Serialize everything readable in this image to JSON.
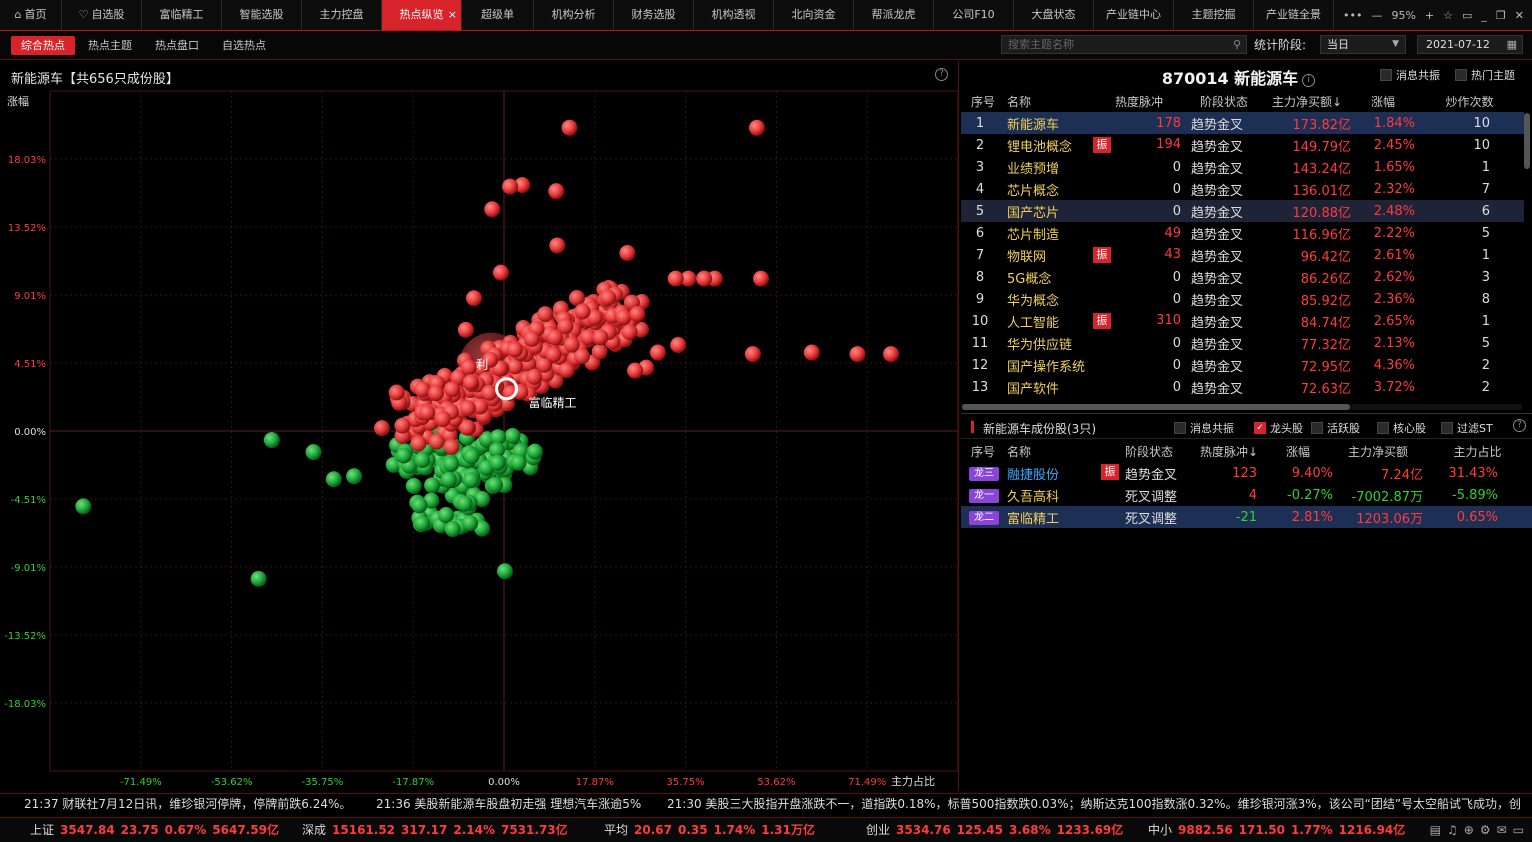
{
  "topbar": {
    "tabs": [
      {
        "label": "首页",
        "icon": "home-icon",
        "w": 62
      },
      {
        "label": "自选股",
        "icon": "heart-icon",
        "w": 80
      },
      {
        "label": "富临精工",
        "w": 80
      },
      {
        "label": "智能选股",
        "w": 80
      },
      {
        "label": "主力控盘",
        "w": 80
      },
      {
        "label": "热点纵览",
        "w": 80,
        "active": true,
        "close": "×"
      },
      {
        "label": "超级单",
        "w": 72
      },
      {
        "label": "机构分析",
        "w": 80
      },
      {
        "label": "财务选股",
        "w": 80
      },
      {
        "label": "机构透视",
        "w": 80
      },
      {
        "label": "北向资金",
        "w": 80
      },
      {
        "label": "帮派龙虎",
        "w": 80
      },
      {
        "label": "公司F10",
        "w": 80
      },
      {
        "label": "大盘状态",
        "w": 80
      },
      {
        "label": "产业链中心",
        "w": 80
      },
      {
        "label": "主题挖掘",
        "w": 80
      },
      {
        "label": "产业链全景",
        "w": 80
      }
    ],
    "zoom": "95%"
  },
  "subbar": {
    "tabs": [
      "综合热点",
      "热点主题",
      "热点盘口",
      "自选热点"
    ],
    "search_placeholder": "搜索主题名称",
    "stat_label": "统计阶段:",
    "stat_value": "当日",
    "date": "2021-07-12"
  },
  "chart_panel": {
    "title": "新能源车【共656只成份股】",
    "ylabel": "涨幅",
    "xlabel": "主力占比",
    "highlight_label": "富临精工",
    "bubble_label": "利",
    "colors": {
      "up": "#e84b4b",
      "down": "#1fa83a",
      "grid": "#5a1a1a"
    }
  },
  "chart_data": {
    "type": "scatter",
    "xlabel": "主力占比",
    "ylabel": "涨幅",
    "x_ticks": [
      "-71.49%",
      "-53.62%",
      "-35.75%",
      "-17.87%",
      "0.00%",
      "17.87%",
      "35.75%",
      "53.62%",
      "71.49%"
    ],
    "y_ticks": [
      "18.03%",
      "13.52%",
      "9.01%",
      "4.51%",
      "0.00%",
      "-4.51%",
      "-9.01%",
      "-13.52%",
      "-18.03%"
    ],
    "xlim": [
      -89.37,
      89.37
    ],
    "ylim": [
      -22.54,
      22.54
    ],
    "outliers": [
      {
        "x": 12.9,
        "y": 20.1
      },
      {
        "x": 49.8,
        "y": 20.1
      },
      {
        "x": 3.6,
        "y": 16.3
      },
      {
        "x": 1.2,
        "y": 16.2
      },
      {
        "x": 10.3,
        "y": 15.9
      },
      {
        "x": -2.3,
        "y": 14.7
      },
      {
        "x": 10.5,
        "y": 12.3
      },
      {
        "x": 24.3,
        "y": 11.8
      },
      {
        "x": -0.6,
        "y": 10.5
      },
      {
        "x": 50.6,
        "y": 10.1
      },
      {
        "x": 41.5,
        "y": 10.1
      },
      {
        "x": 36.3,
        "y": 10.1
      },
      {
        "x": 39.4,
        "y": 10.1
      },
      {
        "x": 33.8,
        "y": 10.1
      },
      {
        "x": 49.0,
        "y": 5.1
      },
      {
        "x": 60.6,
        "y": 5.2
      },
      {
        "x": 69.6,
        "y": 5.1
      },
      {
        "x": 76.2,
        "y": 5.1
      },
      {
        "x": -5.9,
        "y": 8.8
      },
      {
        "x": -7.5,
        "y": 6.7
      },
      {
        "x": 34.3,
        "y": 5.7
      },
      {
        "x": 30.3,
        "y": 5.2
      },
      {
        "x": 28.0,
        "y": 4.2
      },
      {
        "x": 25.8,
        "y": 4.0
      },
      {
        "x": -45.7,
        "y": -0.6
      },
      {
        "x": -37.5,
        "y": -1.4
      },
      {
        "x": -33.5,
        "y": -3.2
      },
      {
        "x": -29.5,
        "y": -3.0
      },
      {
        "x": -82.8,
        "y": -5.0
      },
      {
        "x": -48.3,
        "y": -9.8
      },
      {
        "x": 0.2,
        "y": -9.3
      },
      {
        "x": -10.1,
        "y": -6.5
      }
    ],
    "cloud_up": {
      "x": [
        -12,
        18
      ],
      "y": [
        0,
        9
      ]
    },
    "cloud_down": {
      "x": [
        -25,
        4
      ],
      "y": [
        -6,
        0
      ]
    },
    "highlight": {
      "x": 0.5,
      "y": 2.8
    }
  },
  "right_panel": {
    "title": "870014 新能源车",
    "checks": [
      "消息共振",
      "热门主题"
    ],
    "headers": [
      "序号",
      "名称",
      "热度脉冲",
      "阶段状态",
      "主力净买额↓",
      "涨幅",
      "炒作次数"
    ],
    "rows": [
      {
        "no": "1",
        "name": "新能源车",
        "tag": "",
        "heat": "178",
        "stage": "趋势金叉",
        "net": "173.82亿",
        "chg": "1.84%",
        "times": "10",
        "sel": "sel"
      },
      {
        "no": "2",
        "name": "锂电池概念",
        "tag": "振",
        "heat": "194",
        "stage": "趋势金叉",
        "net": "149.79亿",
        "chg": "2.45%",
        "times": "10"
      },
      {
        "no": "3",
        "name": "业绩预增",
        "tag": "",
        "heat": "0",
        "stage": "趋势金叉",
        "net": "143.24亿",
        "chg": "1.65%",
        "times": "1"
      },
      {
        "no": "4",
        "name": "芯片概念",
        "tag": "",
        "heat": "0",
        "stage": "趋势金叉",
        "net": "136.01亿",
        "chg": "2.32%",
        "times": "7"
      },
      {
        "no": "5",
        "name": "国产芯片",
        "tag": "",
        "heat": "0",
        "stage": "趋势金叉",
        "net": "120.88亿",
        "chg": "2.48%",
        "times": "6",
        "sel": "sel2"
      },
      {
        "no": "6",
        "name": "芯片制造",
        "tag": "",
        "heat": "49",
        "stage": "趋势金叉",
        "net": "116.96亿",
        "chg": "2.22%",
        "times": "5"
      },
      {
        "no": "7",
        "name": "物联网",
        "tag": "振",
        "heat": "43",
        "stage": "趋势金叉",
        "net": "96.42亿",
        "chg": "2.61%",
        "times": "1"
      },
      {
        "no": "8",
        "name": "5G概念",
        "tag": "",
        "heat": "0",
        "stage": "趋势金叉",
        "net": "86.26亿",
        "chg": "2.62%",
        "times": "3"
      },
      {
        "no": "9",
        "name": "华为概念",
        "tag": "",
        "heat": "0",
        "stage": "趋势金叉",
        "net": "85.92亿",
        "chg": "2.36%",
        "times": "8"
      },
      {
        "no": "10",
        "name": "人工智能",
        "tag": "振",
        "heat": "310",
        "stage": "趋势金叉",
        "net": "84.74亿",
        "chg": "2.65%",
        "times": "1"
      },
      {
        "no": "11",
        "name": "华为供应链",
        "tag": "",
        "heat": "0",
        "stage": "趋势金叉",
        "net": "77.32亿",
        "chg": "2.13%",
        "times": "5"
      },
      {
        "no": "12",
        "name": "国产操作系统",
        "tag": "",
        "heat": "0",
        "stage": "趋势金叉",
        "net": "72.95亿",
        "chg": "4.36%",
        "times": "2"
      },
      {
        "no": "13",
        "name": "国产软件",
        "tag": "",
        "heat": "0",
        "stage": "趋势金叉",
        "net": "72.63亿",
        "chg": "3.72%",
        "times": "2"
      }
    ]
  },
  "components": {
    "title": "新能源车成份股(3只)",
    "checks": [
      {
        "label": "消息共振",
        "on": false
      },
      {
        "label": "龙头股",
        "on": true
      },
      {
        "label": "活跃股",
        "on": false
      },
      {
        "label": "核心股",
        "on": false
      },
      {
        "label": "过滤ST",
        "on": false
      }
    ],
    "headers": [
      "序号",
      "名称",
      "阶段状态",
      "热度脉冲↓",
      "涨幅",
      "主力净买额",
      "主力占比"
    ],
    "rows": [
      {
        "badge": "龙三",
        "name": "融捷股份",
        "tag": "振",
        "stage": "趋势金叉",
        "heat": "123",
        "heat_c": "red",
        "chg": "9.40%",
        "chg_c": "red",
        "net": "7.24亿",
        "net_c": "red",
        "pct": "31.43%",
        "pct_c": "red",
        "link": true
      },
      {
        "badge": "龙一",
        "name": "久吾高科",
        "tag": "",
        "stage": "死叉调整",
        "heat": "4",
        "heat_c": "red",
        "chg": "-0.27%",
        "chg_c": "green",
        "net": "-7002.87万",
        "net_c": "green",
        "pct": "-5.89%",
        "pct_c": "green"
      },
      {
        "badge": "龙二",
        "name": "富临精工",
        "tag": "",
        "stage": "死叉调整",
        "heat": "-21",
        "heat_c": "green",
        "chg": "2.81%",
        "chg_c": "red",
        "net": "1203.06万",
        "net_c": "red",
        "pct": "0.65%",
        "pct_c": "red",
        "sel": true
      }
    ]
  },
  "news": [
    "21:37 财联社7月12日讯，维珍银河停牌，停牌前跌6.24%。",
    "21:36 美股新能源车股盘初走强 理想汽车涨逾5%",
    "21:30 美股三大股指开盘涨跌不一，道指跌0.18%，标普500指数跌0.03%；纳斯达克100指数涨0.32%。维珍银河涨3%，该公司“团结”号太空船试飞成功，创"
  ],
  "indices": [
    {
      "name": "上证",
      "v": "3547.84",
      "c": "23.75",
      "p": "0.67%",
      "a": "5647.59亿"
    },
    {
      "name": "深成",
      "v": "15161.52",
      "c": "317.17",
      "p": "2.14%",
      "a": "7531.73亿"
    },
    {
      "name": "平均",
      "v": "20.67",
      "c": "0.35",
      "p": "1.74%",
      "a": "1.31万亿"
    },
    {
      "name": "创业",
      "v": "3534.76",
      "c": "125.45",
      "p": "3.68%",
      "a": "1233.69亿"
    },
    {
      "name": "中小",
      "v": "9882.56",
      "c": "171.50",
      "p": "1.77%",
      "a": "1216.94亿"
    }
  ]
}
